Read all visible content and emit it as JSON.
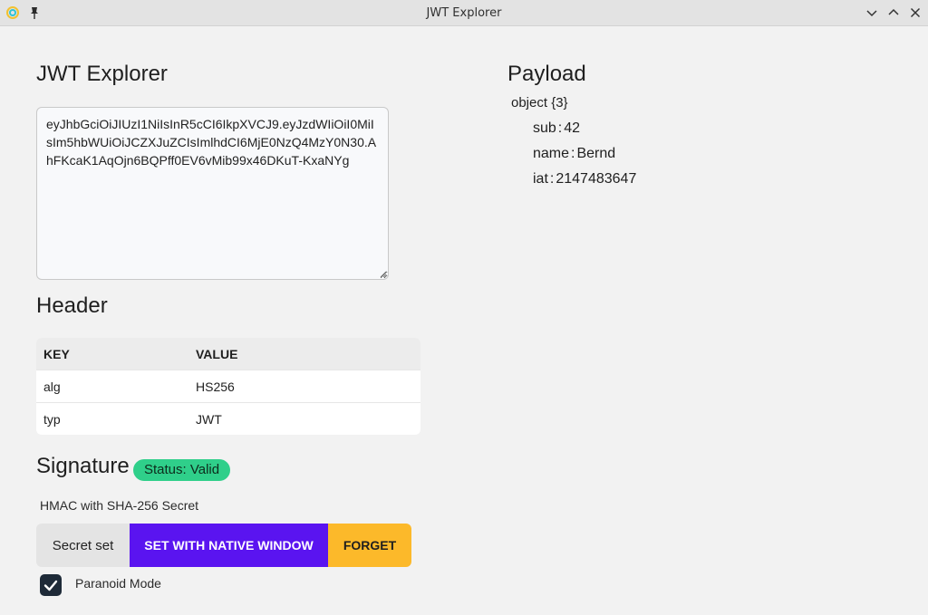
{
  "window": {
    "title": "JWT Explorer",
    "icons": [
      "app-logo-icon",
      "pin-icon",
      "minimize-chevron-icon",
      "maximize-chevron-icon",
      "close-icon"
    ]
  },
  "main": {
    "title": "JWT Explorer",
    "token": "eyJhbGciOiJIUzI1NiIsInR5cCI6IkpXVCJ9.eyJzdWIiOiI0MiIsIm5hbWUiOiJCZXJuZCIsImlhdCI6MjE0NzQ4MzY0N30.AhFKcaK1AqOjn6BQPff0EV6vMib99x46DKuT-KxaNYg"
  },
  "header": {
    "title": "Header",
    "columns": [
      "KEY",
      "VALUE"
    ],
    "rows": [
      {
        "key": "alg",
        "value": "HS256"
      },
      {
        "key": "typ",
        "value": "JWT"
      }
    ]
  },
  "signature": {
    "title": "Signature",
    "status": "Status: Valid",
    "status_color": "#2fcf8a",
    "algorithm_label": "HMAC with SHA-256 Secret",
    "secret_state": "Secret set",
    "set_native_label": "SET WITH NATIVE WINDOW",
    "forget_label": "FORGET",
    "paranoid_label": "Paranoid Mode",
    "paranoid_checked": true,
    "accent_colors": {
      "native": "#5a14f0",
      "forget": "#fcb92a"
    }
  },
  "payload": {
    "title": "Payload",
    "root_label": "object {3}",
    "items": [
      {
        "key": "sub",
        "value": "42"
      },
      {
        "key": "name",
        "value": "Bernd"
      },
      {
        "key": "iat",
        "value": "2147483647"
      }
    ],
    "separator": ":"
  }
}
